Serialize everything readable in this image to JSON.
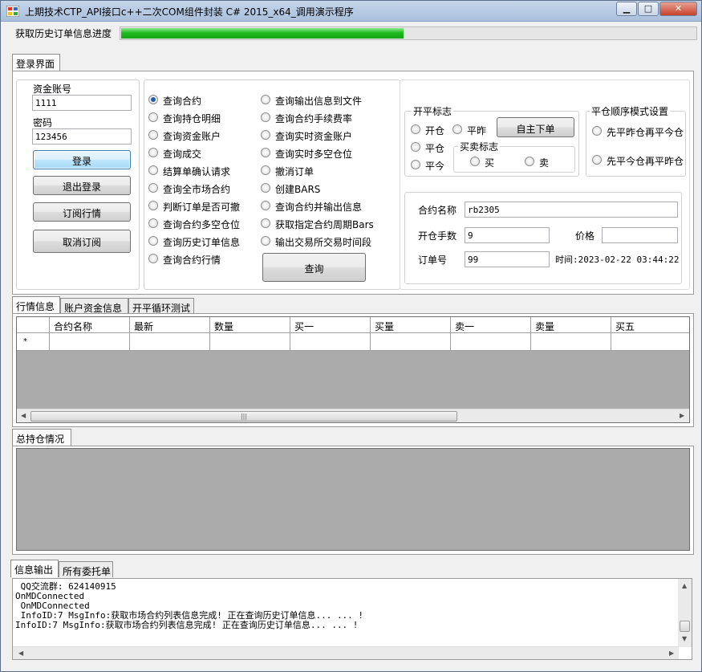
{
  "window": {
    "title": "上期技术CTP_API接口c++二次COM组件封装 C# 2015_x64_调用演示程序",
    "controls": {
      "minimize": "▁",
      "maximize": "□",
      "close": "✕"
    }
  },
  "progress": {
    "label": "获取历史订单信息进度",
    "fraction": 0.49
  },
  "top_tab": {
    "label": "登录界面"
  },
  "login": {
    "account_label": "资金账号",
    "account_value": "1111",
    "password_label": "密码",
    "password_value": "123456",
    "login_button": "登录",
    "logout_button": "退出登录",
    "subscribe_button": "订阅行情",
    "unsubscribe_button": "取消订阅"
  },
  "queries": {
    "left": [
      "查询合约",
      "查询持仓明细",
      "查询资金账户",
      "查询成交",
      "结算单确认请求",
      "查询全市场合约",
      "判断订单是否可撤",
      "查询合约多空仓位",
      "查询历史订单信息",
      "查询合约行情"
    ],
    "right": [
      "查询输出信息到文件",
      "查询合约手续费率",
      "查询实时资金账户",
      "查询实时多空仓位",
      "撤消订单",
      "创建BARS",
      "查询合约并输出信息",
      "获取指定合约周期Bars",
      "输出交易所交易时间段"
    ],
    "selected": "查询合约",
    "query_button": "查询"
  },
  "order": {
    "open_close_group": "开平标志",
    "open": "开仓",
    "close_yesterday": "平昨",
    "close": "平仓",
    "close_today": "平今",
    "buy_sell_group": "买卖标志",
    "buy": "买",
    "sell": "卖",
    "manual_order_button": "自主下单",
    "close_order_group": "平仓顺序模式设置",
    "close_order_opt1": "先平昨仓再平今仓",
    "close_order_opt2": "先平今仓再平昨仓",
    "contract_label": "合约名称",
    "contract_value": "rb2305",
    "lots_label": "开仓手数",
    "lots_value": "9",
    "price_label": "价格",
    "price_value": "",
    "order_no_label": "订单号",
    "order_no_value": "99",
    "time_text": "时间:2023-02-22 03:44:22"
  },
  "mid_tabs": [
    "行情信息",
    "账户资金信息",
    "开平循环测试"
  ],
  "grid": {
    "columns": [
      "合约名称",
      "最新",
      "数量",
      "买一",
      "买量",
      "卖一",
      "卖量",
      "买五"
    ],
    "new_row_marker": "*",
    "scroll_grip": "|||"
  },
  "position_tab": "总持仓情况",
  "bottom_tabs": [
    "信息输出",
    "所有委托单"
  ],
  "log_lines": [
    " QQ交流群: 624140915",
    "OnMDConnected",
    " OnMDConnected",
    " InfoID:7 MsgInfo:获取市场合约列表信息完成! 正在查询历史订单信息... ... !",
    "InfoID:7 MsgInfo:获取市场合约列表信息完成! 正在查询历史订单信息... ... !"
  ],
  "scroll_arrows": {
    "up": "▲",
    "down": "▼",
    "left": "◀",
    "right": "▶"
  },
  "colors": {
    "progress": "#1fbb1f",
    "grid_bg": "#ababab",
    "titlebar": "#b7cae3"
  }
}
